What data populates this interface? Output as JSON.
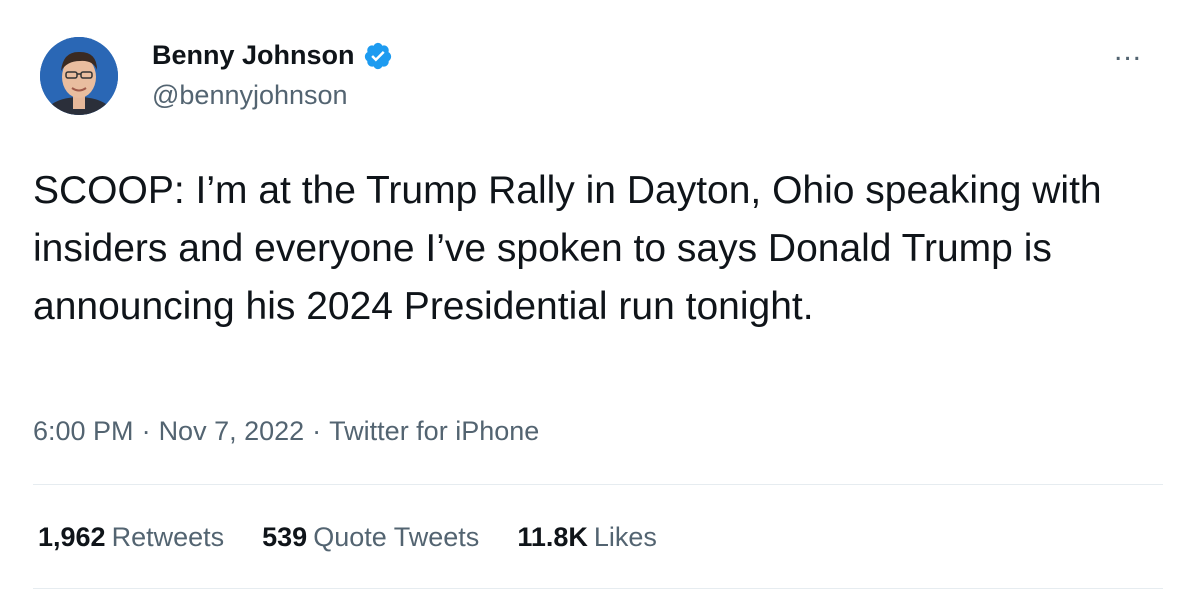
{
  "author": {
    "name": "Benny Johnson",
    "handle": "@bennyjohnson",
    "verified_icon": "verified-badge-icon",
    "badge_color": "#1d9bf0"
  },
  "menu": {
    "label": "..."
  },
  "tweet": {
    "text": "SCOOP: I’m at the Trump Rally in Dayton, Ohio speaking with insiders and everyone I’ve spoken to says Donald Trump is announcing his 2024 Presidential run tonight.",
    "time": "6:00 PM",
    "separator": "·",
    "date": "Nov 7, 2022",
    "source": "Twitter for iPhone"
  },
  "stats": {
    "retweets_count": "1,962",
    "retweets_label": "Retweets",
    "quotes_count": "539",
    "quotes_label": "Quote Tweets",
    "likes_count": "11.8K",
    "likes_label": "Likes"
  }
}
